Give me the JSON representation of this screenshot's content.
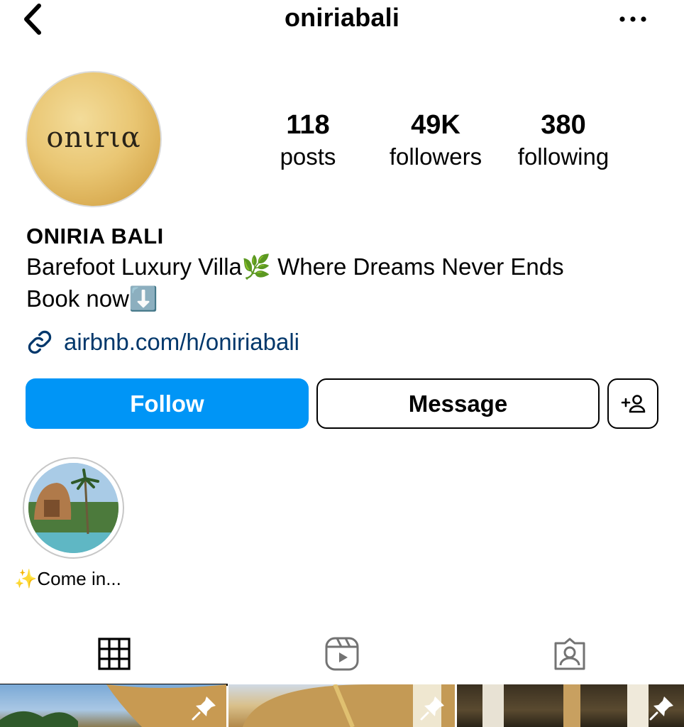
{
  "header": {
    "username": "oniriabali",
    "back_icon": "chevron-left-icon",
    "more_icon": "more-horizontal-icon"
  },
  "avatar": {
    "logo_text": "onιrια"
  },
  "stats": [
    {
      "value": "118",
      "label": "posts"
    },
    {
      "value": "49K",
      "label": "followers"
    },
    {
      "value": "380",
      "label": "following"
    }
  ],
  "bio": {
    "name": "ONIRIA BALI",
    "line1": "Barefoot Luxury Villa🌿 Where Dreams Never Ends",
    "line2": "Book now⬇️",
    "link": "airbnb.com/h/oniriabali"
  },
  "actions": {
    "follow": "Follow",
    "message": "Message"
  },
  "highlights": [
    {
      "label": "✨Come in..."
    }
  ],
  "tabs": [
    {
      "name": "grid"
    },
    {
      "name": "reels"
    },
    {
      "name": "tagged"
    }
  ],
  "colors": {
    "accent": "#0095f6",
    "link": "#00376b"
  }
}
